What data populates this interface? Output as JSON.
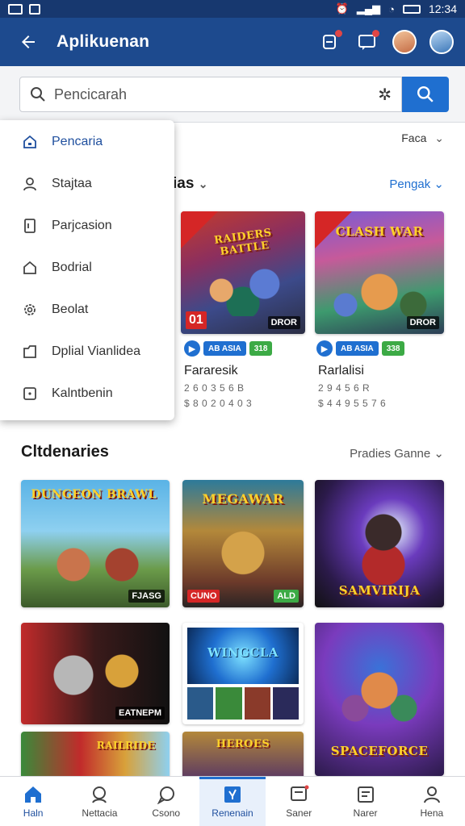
{
  "status_bar": {
    "time": "12:34"
  },
  "app_bar": {
    "title": "Aplikuenan",
    "back_icon": "arrow-left-icon"
  },
  "search": {
    "placeholder": "Pencicarah"
  },
  "filter": {
    "label": "Faca"
  },
  "dropdown": {
    "items": [
      {
        "label": "Pencaria",
        "icon": "home-icon"
      },
      {
        "label": "Stajtaa",
        "icon": "user-icon"
      },
      {
        "label": "Parjcasion",
        "icon": "document-icon"
      },
      {
        "label": "Bodrial",
        "icon": "house-icon"
      },
      {
        "label": "Beolat",
        "icon": "gear-icon"
      },
      {
        "label": "Dplial Vianlidea",
        "icon": "folder-icon"
      },
      {
        "label": "Kalntbenin",
        "icon": "calendar-icon"
      }
    ]
  },
  "section1": {
    "title_partial": "ias",
    "link": "Pengak",
    "games": [
      {
        "name": "Fararesik",
        "meta1": "2 6 0 3 5 6 B",
        "meta2": "$ 8 0 2 0 4 0 3",
        "logo": "RAIDERS BATTLE",
        "corner_tag": "01",
        "tag": "DROR",
        "badge1": "AB ASIA",
        "badge2": "318"
      },
      {
        "name": "Rarlalisi",
        "meta1": "2 9 4 5 6 R",
        "meta2": "$ 4 4 9 5 5 7 6",
        "logo": "CLASH WAR",
        "tag": "DROR",
        "badge1": "AB ASIA",
        "badge2": "338"
      }
    ]
  },
  "section2": {
    "title": "Cltdenaries",
    "link": "Pradies Ganne",
    "cards": [
      {
        "logo": "DUNGEON BRAWL",
        "tag": "FJASG"
      },
      {
        "logo": "MEGAWAR",
        "tag": "CUNO",
        "tag2": "ALD"
      },
      {
        "logo": "SAMVIRIJA",
        "tag": ""
      },
      {
        "logo": "",
        "tag": "EATNEPM"
      },
      {
        "logo": "WINGCLA",
        "tag": ""
      },
      {
        "logo": "SPACEFORCE",
        "tag": ""
      },
      {
        "logo": "RAILRIDE",
        "tag": ""
      },
      {
        "logo": "HEROES",
        "tag": ""
      }
    ]
  },
  "bottom_nav": [
    {
      "label": "Haln",
      "icon": "home-icon"
    },
    {
      "label": "Nettacia",
      "icon": "search-icon"
    },
    {
      "label": "Csono",
      "icon": "chat-icon"
    },
    {
      "label": "Renenain",
      "icon": "sparkle-icon"
    },
    {
      "label": "Saner",
      "icon": "cart-icon"
    },
    {
      "label": "Narer",
      "icon": "news-icon"
    },
    {
      "label": "Hena",
      "icon": "profile-icon"
    }
  ],
  "colors": {
    "primary": "#1d4a8e",
    "accent": "#1f6fd0",
    "status_bar": "#17386f"
  }
}
